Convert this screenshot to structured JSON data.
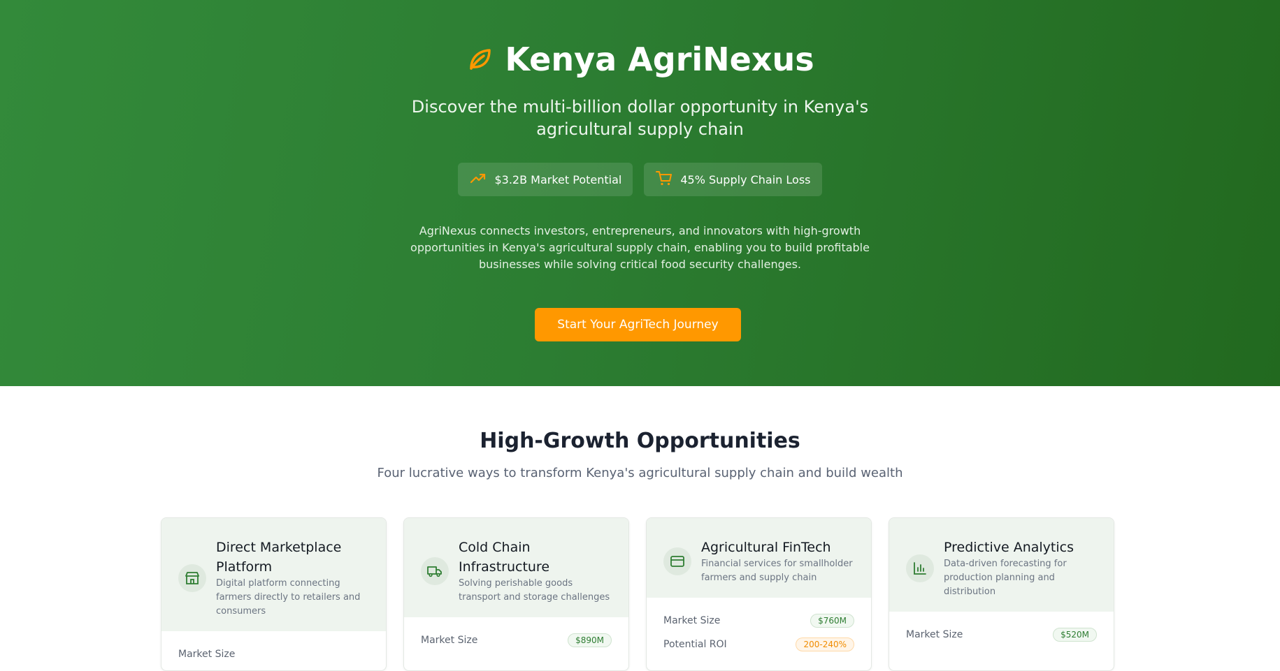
{
  "hero": {
    "title": "Kenya AgriNexus",
    "subtitle": "Discover the multi-billion dollar opportunity in Kenya's agricultural supply chain",
    "stats": [
      {
        "icon": "trending-up-icon",
        "label": "$3.2B Market Potential"
      },
      {
        "icon": "shopping-cart-icon",
        "label": "45% Supply Chain Loss"
      }
    ],
    "description": "AgriNexus connects investors, entrepreneurs, and innovators with high-growth opportunities in Kenya's agricultural supply chain, enabling you to build profitable businesses while solving critical food security challenges.",
    "cta_label": "Start Your AgriTech Journey"
  },
  "opportunities": {
    "title": "High-Growth Opportunities",
    "subtitle": "Four lucrative ways to transform Kenya's agricultural supply chain and build wealth",
    "cards": [
      {
        "icon": "store-icon",
        "title": "Direct Marketplace Platform",
        "description": "Digital platform connecting farmers directly to retailers and consumers",
        "market_size_label": "Market Size",
        "market_size": "",
        "roi_label": "",
        "roi": ""
      },
      {
        "icon": "truck-icon",
        "title": "Cold Chain Infrastructure",
        "description": "Solving perishable goods transport and storage challenges",
        "market_size_label": "Market Size",
        "market_size": "$890M",
        "roi_label": "",
        "roi": ""
      },
      {
        "icon": "credit-card-icon",
        "title": "Agricultural FinTech",
        "description": "Financial services for smallholder farmers and supply chain",
        "market_size_label": "Market Size",
        "market_size": "$760M",
        "roi_label": "Potential ROI",
        "roi": "200-240%"
      },
      {
        "icon": "bar-chart-icon",
        "title": "Predictive Analytics",
        "description": "Data-driven forecasting for production planning and distribution",
        "market_size_label": "Market Size",
        "market_size": "$520M",
        "roi_label": "",
        "roi": ""
      }
    ]
  },
  "colors": {
    "brand_green": "#2e7d32",
    "accent_orange": "#ff9800"
  }
}
